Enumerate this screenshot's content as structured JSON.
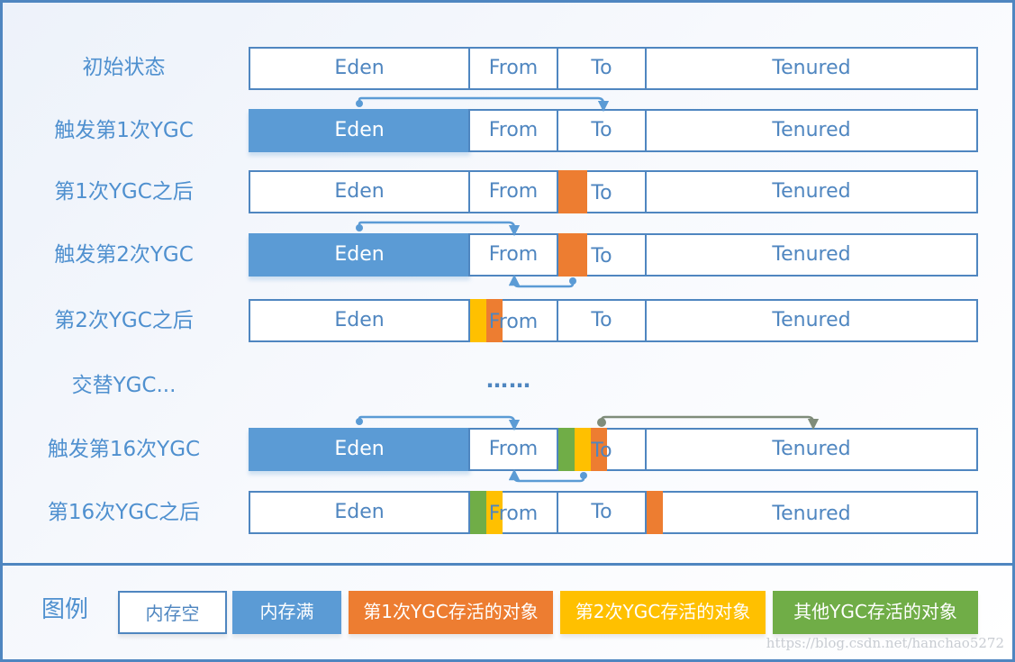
{
  "colors": {
    "border": "#4f86c0",
    "label_text": "#4f90cf",
    "memory_full": "#5b9bd5",
    "survivor_1st": "#ed7d31",
    "survivor_2nd": "#ffc000",
    "survivor_other": "#70ad47",
    "promotion_arrow": "#7f8c7a"
  },
  "regions": [
    "Eden",
    "From",
    "To",
    "Tenured"
  ],
  "rows": [
    {
      "label": "初始状态"
    },
    {
      "label": "触发第1次YGC"
    },
    {
      "label": "第1次YGC之后"
    },
    {
      "label": "触发第2次YGC"
    },
    {
      "label": "第2次YGC之后"
    },
    {
      "label": "交替YGC..."
    },
    {
      "label": "触发第16次YGC"
    },
    {
      "label": "第16次YGC之后"
    }
  ],
  "ellipsis": "……",
  "legend": {
    "title": "图例",
    "items": [
      {
        "label": "内存空",
        "color": "#ffffff"
      },
      {
        "label": "内存满",
        "color": "#5b9bd5"
      },
      {
        "label": "第1次YGC存活的对象",
        "color": "#ed7d31"
      },
      {
        "label": "第2次YGC存活的对象",
        "color": "#ffc000"
      },
      {
        "label": "其他YGC存活的对象",
        "color": "#70ad47"
      }
    ]
  },
  "watermark": "https://blog.csdn.net/hanchao5272"
}
